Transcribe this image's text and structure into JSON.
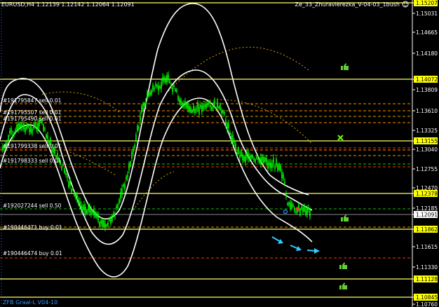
{
  "header": {
    "symbol_info": "EURUSD,H4  1.12139 1.12142 1.12064 1.12091",
    "indicator_name": "Ze_33_Zhuravlerezka_V-04-03_1bush",
    "footer_label": "ZFB Graal-L V04-10"
  },
  "colors": {
    "background": "#000000",
    "candle": "#00ff00",
    "band": "#ffffff",
    "level_line": "#ffff66",
    "orange_dash": "#ff8c00",
    "gold_dash": "#d4a500",
    "red_dash": "#ff3300",
    "green_dash": "#00cc00",
    "arrow": "#33ccff",
    "thumb": "#66cc33",
    "cross": "#66ff00",
    "highlight_box": "#ffff00"
  },
  "chart_data": {
    "type": "candlestick",
    "y_axis_ticks": [
      "1.15207",
      "1.15031",
      "1.14665",
      "1.14180",
      "1.14072",
      "1.13809",
      "1.13610",
      "1.13325",
      "1.13155",
      "1.13040",
      "1.12755",
      "1.12470",
      "1.12378",
      "1.12185",
      "1.12091",
      "1.11862",
      "1.11615",
      "1.11330",
      "1.11128",
      "1.10845",
      "1.10760"
    ],
    "highlighted_ticks": [
      "1.15207",
      "1.14072",
      "1.13155",
      "1.12378",
      "1.11862",
      "1.11128",
      "1.10845"
    ],
    "current_price_tick": "1.12091",
    "horizontal_levels": [
      "1.15207",
      "1.14072",
      "1.13155",
      "1.12378",
      "1.11862",
      "1.11128",
      "1.10845"
    ],
    "order_labels": [
      {
        "text": "#191795847 sell 0.01"
      },
      {
        "text": "#191795507 sell 0.01"
      },
      {
        "text": "#191795490 sell 0.01"
      },
      {
        "text": "#191799338 sell 0.01"
      },
      {
        "text": "#191798333 sell 0.01"
      },
      {
        "text": "#192027244 sell 0.50"
      },
      {
        "text": "#190446471 buy 0.01"
      },
      {
        "text": "#190446474 buy 0.01"
      }
    ]
  }
}
